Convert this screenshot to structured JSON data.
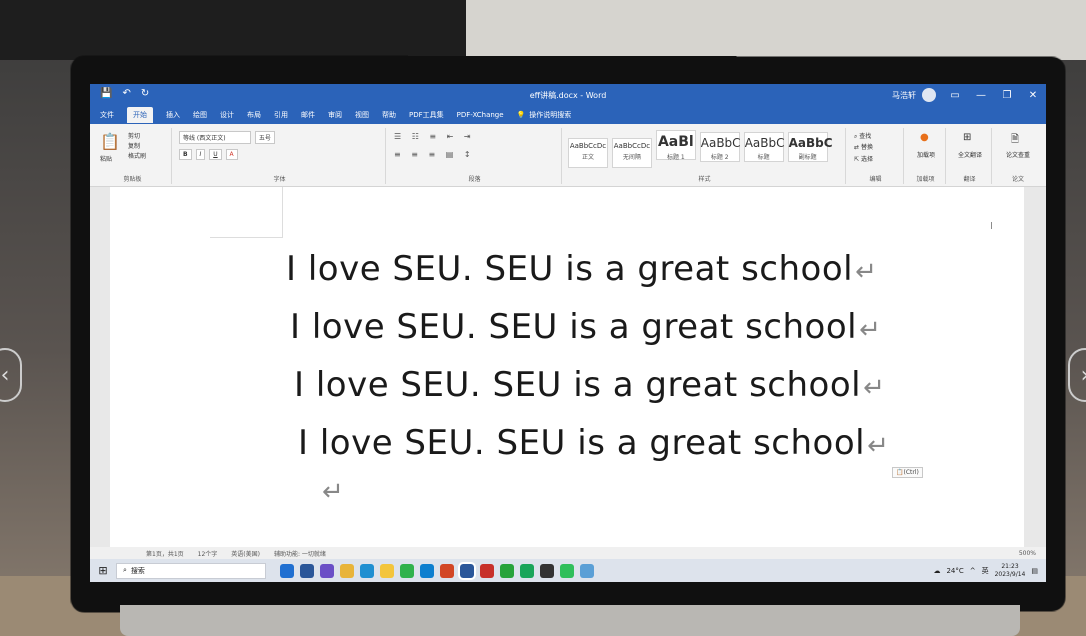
{
  "titlebar": {
    "quick_access": [
      "💾",
      "↶",
      "↻"
    ],
    "document_title": "eff讲稿.docx - Word",
    "user_name": "马浩轩",
    "window_controls": [
      "▭",
      "—",
      "❐",
      "✕"
    ]
  },
  "ribbon_tabs": [
    "文件",
    "开始",
    "插入",
    "绘图",
    "设计",
    "布局",
    "引用",
    "邮件",
    "审阅",
    "视图",
    "帮助",
    "PDF工具集",
    "PDF-XChange"
  ],
  "active_tab": "开始",
  "tell_me": "操作说明搜索",
  "ribbon": {
    "clipboard": {
      "paste": "粘贴",
      "cut": "剪切",
      "copy": "复制",
      "format_painter": "格式刷",
      "label": "剪贴板"
    },
    "font": {
      "font_name": "等线 (西文正文)",
      "font_size": "五号",
      "bold": "B",
      "italic": "I",
      "underline": "U",
      "label": "字体"
    },
    "paragraph": {
      "label": "段落"
    },
    "styles": {
      "tiles": [
        {
          "preview": "AaBbCcDc",
          "name": "正文"
        },
        {
          "preview": "AaBbCcDc",
          "name": "无间隔"
        },
        {
          "preview": "AaBl",
          "name": "标题 1"
        },
        {
          "preview": "AaBbC",
          "name": "标题 2"
        },
        {
          "preview": "AaBbC",
          "name": "标题"
        },
        {
          "preview": "AaBbC",
          "name": "副标题"
        }
      ],
      "label": "样式"
    },
    "editing": {
      "find": "查找",
      "replace": "替换",
      "select": "选择",
      "label": "编辑"
    },
    "addins": {
      "button": "加载项",
      "label": "加载项"
    },
    "translate": {
      "button": "全文翻译",
      "label": "翻译"
    },
    "paper": {
      "button": "论文查重",
      "label": "论文"
    }
  },
  "document": {
    "lines": [
      "I love SEU. SEU is a great school",
      "I love SEU. SEU is a great school",
      "I love SEU. SEU is a great school",
      "I love SEU. SEU is a great school"
    ],
    "paragraph_mark": "↵",
    "paste_options": "(Ctrl)"
  },
  "statusbar": {
    "page": "第1页，共1页",
    "words": "12个字",
    "language": "英语(美国)",
    "accessibility": "辅助功能: 一切就绪",
    "zoom": "500%"
  },
  "taskbar": {
    "search_placeholder": "搜索",
    "temperature": "24°C",
    "ime": "英",
    "time": "21:23",
    "date": "2023/9/14"
  }
}
